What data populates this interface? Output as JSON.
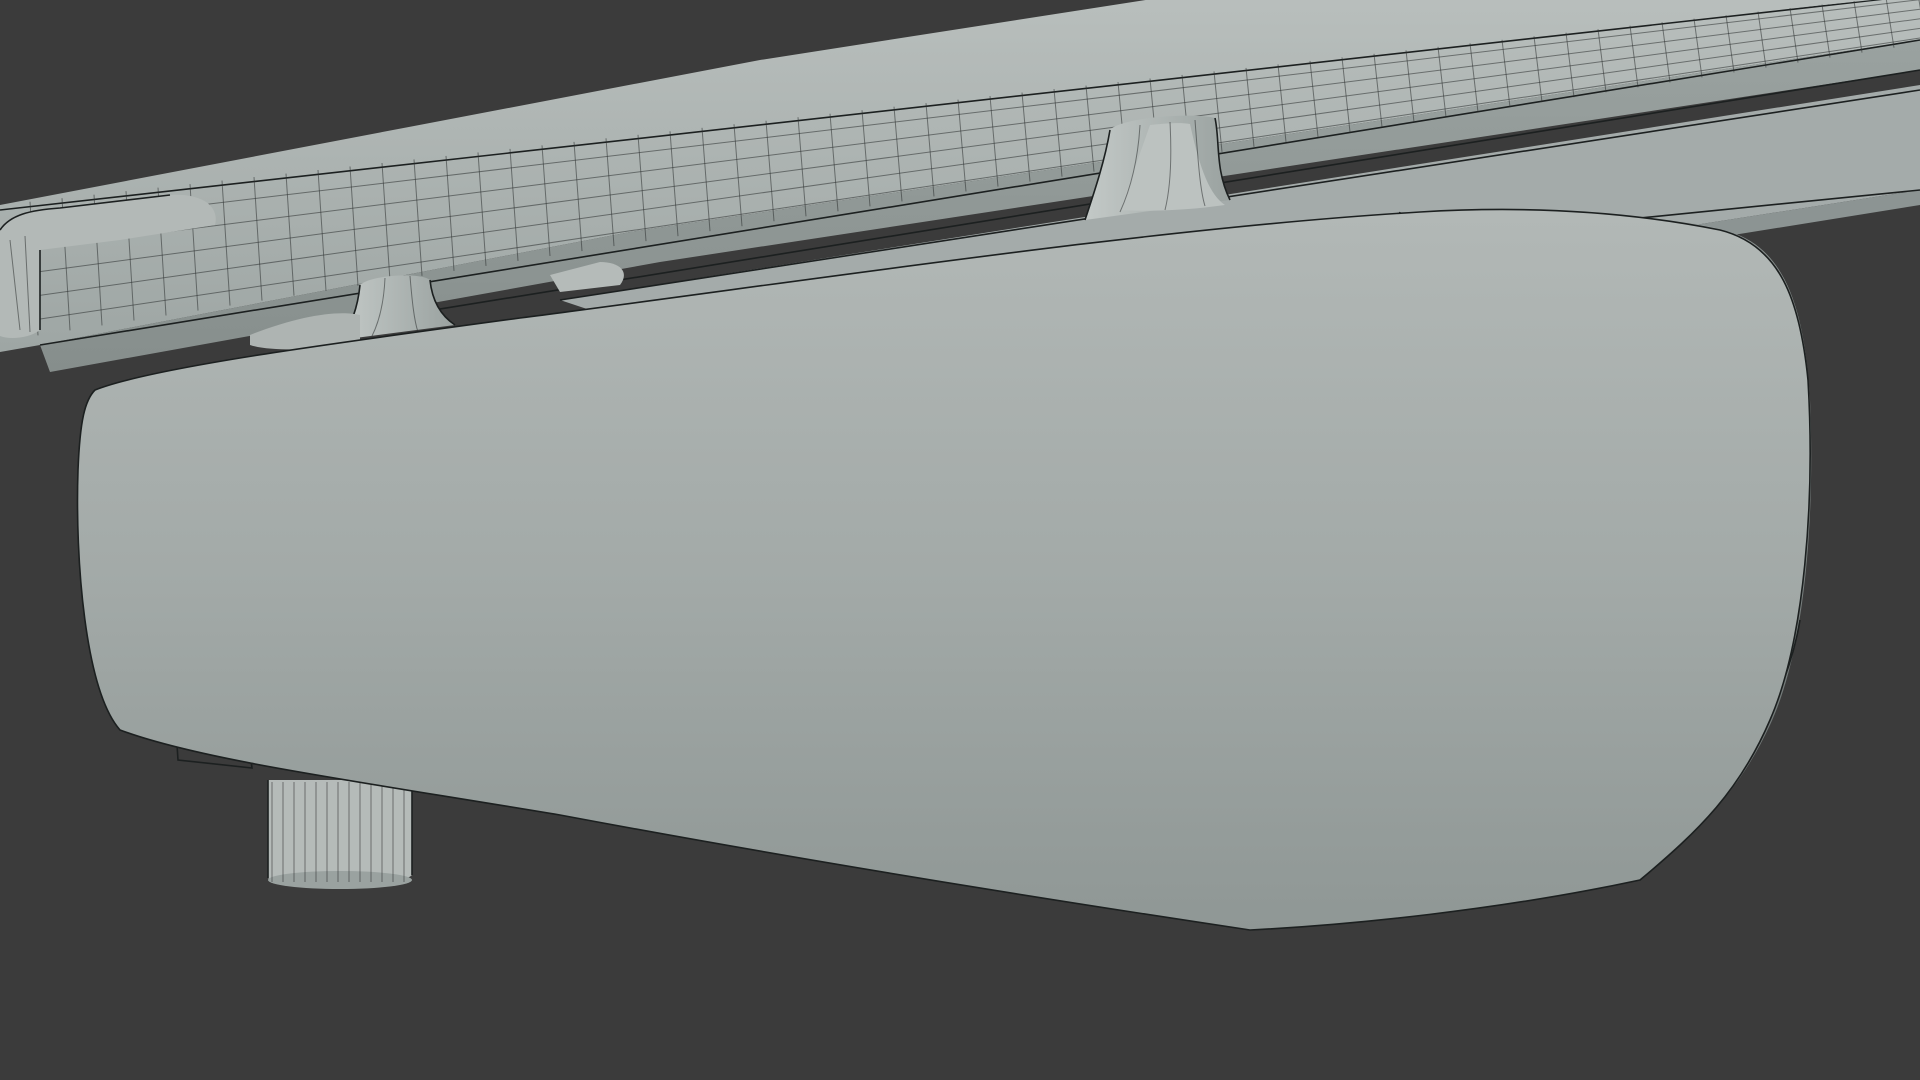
{
  "scene": {
    "view": "3d-viewport",
    "display_mode": "shaded-with-wireframe",
    "subject": "suspended-monorail-car",
    "background_color": "#3b3b3b",
    "surface_color": "#a7aeac",
    "shadow_color": "#7d8483",
    "wire_color": "#2b302f",
    "edge_color": "#141717"
  }
}
